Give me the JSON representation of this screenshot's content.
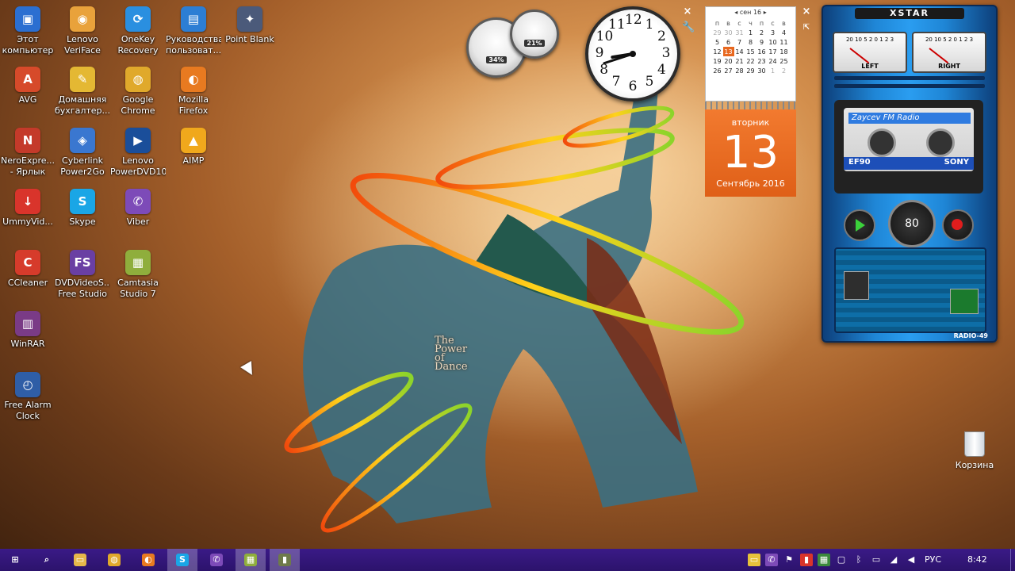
{
  "desktop": {
    "icons": [
      {
        "label": "Этот компьютер",
        "color": "#2b6fd1",
        "glyph": "▣"
      },
      {
        "label": "Lenovo VeriFace",
        "color": "#e9a23b",
        "glyph": "◉"
      },
      {
        "label": "OneKey Recovery",
        "color": "#2a8fe0",
        "glyph": "⟳"
      },
      {
        "label": "Руководства пользоват...",
        "color": "#2c7ed4",
        "glyph": "▤"
      },
      {
        "label": "Point Blank",
        "color": "#4b5a7a",
        "glyph": "✦"
      },
      {
        "label": "AVG",
        "color": "#d64a2a",
        "glyph": "A"
      },
      {
        "label": "Домашняя бухгалтер...",
        "color": "#e4b833",
        "glyph": "✎"
      },
      {
        "label": "Google Chrome",
        "color": "#e0a92b",
        "glyph": "◍"
      },
      {
        "label": "Mozilla Firefox",
        "color": "#e87a20",
        "glyph": "◐"
      },
      {
        "label": "NeroExpre... - Ярлык",
        "color": "#c43a2a",
        "glyph": "N"
      },
      {
        "label": "Cyberlink Power2Go",
        "color": "#3a77d0",
        "glyph": "◈"
      },
      {
        "label": "Lenovo PowerDVD10",
        "color": "#1a4e9a",
        "glyph": "▶"
      },
      {
        "label": "AIMP",
        "color": "#f0a81c",
        "glyph": "▲"
      },
      {
        "label": "UmmyVid...",
        "color": "#d9342b",
        "glyph": "↓"
      },
      {
        "label": "Skype",
        "color": "#1aa6e6",
        "glyph": "S"
      },
      {
        "label": "Viber",
        "color": "#7d4bb8",
        "glyph": "✆"
      },
      {
        "label": "CCleaner",
        "color": "#d63b2b",
        "glyph": "C"
      },
      {
        "label": "DVDVideoS... Free Studio",
        "color": "#6a3fa3",
        "glyph": "FS"
      },
      {
        "label": "Camtasia Studio 7",
        "color": "#8fae3c",
        "glyph": "▦"
      },
      {
        "label": "WinRAR",
        "color": "#7a3b86",
        "glyph": "▥"
      },
      {
        "label": "Free Alarm Clock",
        "color": "#2f5ea6",
        "glyph": "◴"
      }
    ],
    "recycle_bin": "Корзина",
    "art_caption": [
      "The",
      "Power",
      "of",
      "Dance"
    ]
  },
  "gadgets": {
    "cpu_meter": {
      "cpu": "34%",
      "ram": "21%"
    },
    "clock": {
      "numbers": [
        "12",
        "1",
        "2",
        "3",
        "4",
        "5",
        "6",
        "7",
        "8",
        "9",
        "10",
        "11"
      ],
      "hour": 8.7,
      "minute": 42
    },
    "calendar": {
      "month_header": "сен 16",
      "weekdays": [
        "п",
        "в",
        "с",
        "ч",
        "п",
        "с",
        "в"
      ],
      "weeks": [
        [
          "29",
          "30",
          "31",
          "1",
          "2",
          "3",
          "4"
        ],
        [
          "5",
          "6",
          "7",
          "8",
          "9",
          "10",
          "11"
        ],
        [
          "12",
          "13",
          "14",
          "15",
          "16",
          "17",
          "18"
        ],
        [
          "19",
          "20",
          "21",
          "22",
          "23",
          "24",
          "25"
        ],
        [
          "26",
          "27",
          "28",
          "29",
          "30",
          "1",
          "2"
        ]
      ],
      "day_of_week": "вторник",
      "day": "13",
      "month_year": "Сентябрь 2016"
    },
    "radio": {
      "title": "XSTAR",
      "left_label": "LEFT",
      "right_label": "RIGHT",
      "scale": "20 10 5 2 0 1 2 3",
      "station": "Zaycev FM Radio",
      "tape_left": "EF90",
      "tape_right": "SONY",
      "volume": "80",
      "footer": "RADIO-49"
    }
  },
  "taskbar": {
    "apps": [
      {
        "name": "start",
        "glyph": "⊞",
        "color": "transparent"
      },
      {
        "name": "search",
        "glyph": "⌕",
        "color": "transparent"
      },
      {
        "name": "file-explorer",
        "glyph": "▭",
        "color": "#e6b84a"
      },
      {
        "name": "chrome",
        "glyph": "◍",
        "color": "#e0a92b"
      },
      {
        "name": "firefox",
        "glyph": "◐",
        "color": "#e87a20"
      },
      {
        "name": "skype",
        "glyph": "S",
        "color": "#1aa6e6"
      },
      {
        "name": "viber",
        "glyph": "✆",
        "color": "#7d4bb8"
      },
      {
        "name": "camtasia",
        "glyph": "▦",
        "color": "#8fae3c"
      },
      {
        "name": "recorder",
        "glyph": "▮",
        "color": "#6e7a4a"
      }
    ],
    "language": "РУС",
    "time": "8:42"
  }
}
